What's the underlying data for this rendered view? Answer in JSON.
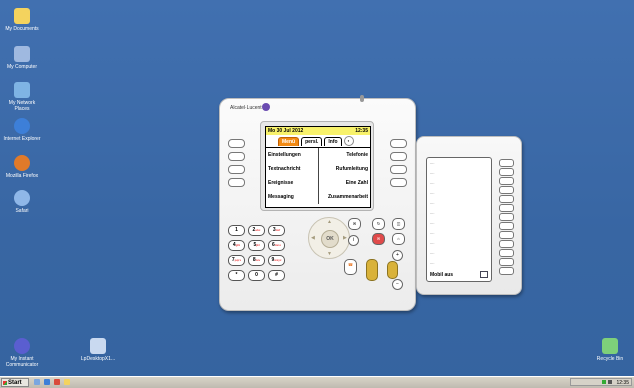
{
  "desktop": {
    "icons": [
      {
        "label": "My Documents",
        "color": "#f4d35e"
      },
      {
        "label": "My Computer",
        "color": "#9fb9e0"
      },
      {
        "label": "My Network Places",
        "color": "#7fb4e4"
      },
      {
        "label": "Internet Explorer",
        "color": "#3d7fd8"
      },
      {
        "label": "Mozilla Firefox",
        "color": "#e07a2a"
      },
      {
        "label": "Safari",
        "color": "#8fb7e8"
      },
      {
        "label": "My Instant Communicator",
        "color": "#5a5ed0"
      },
      {
        "label": "LpDesktopX1...",
        "color": "#c9d9f0"
      },
      {
        "label": "Recycle Bin",
        "color": "#7ed07a"
      }
    ]
  },
  "taskbar": {
    "start_label": "Start",
    "clock": "12:35"
  },
  "phone": {
    "brand": "Alcatel·Lucent",
    "screen": {
      "date": "Mo 30 Jul 2012",
      "time": "12:35",
      "tabs": [
        "Menü",
        "persl.",
        "Info"
      ],
      "left_items": [
        "Einstellungen",
        "Textnachricht",
        "Ereignisse",
        "Messaging"
      ],
      "right_items": [
        "Telefonie",
        "Rufumleitung",
        "Eine Zahl",
        "Zusammenarbeit"
      ]
    },
    "keypad": [
      "1",
      "2",
      "3",
      "4",
      "5",
      "6",
      "7",
      "8",
      "9",
      "*",
      "0",
      "#"
    ],
    "keypad_sub": [
      "",
      "abc",
      "def",
      "ghi",
      "jkl",
      "mno",
      "pqrs",
      "tuv",
      "wxyz",
      "",
      "",
      ""
    ],
    "nav_ok": "OK",
    "colors": {
      "tab_active": "#f28a14",
      "screen_header": "#f8f26b",
      "hook": "#d9b23a"
    }
  },
  "extension": {
    "rows": [
      "....",
      "....",
      "....",
      "....",
      "....",
      "....",
      "....",
      "....",
      "....",
      "....",
      "...."
    ],
    "status": "Mobil aus"
  }
}
